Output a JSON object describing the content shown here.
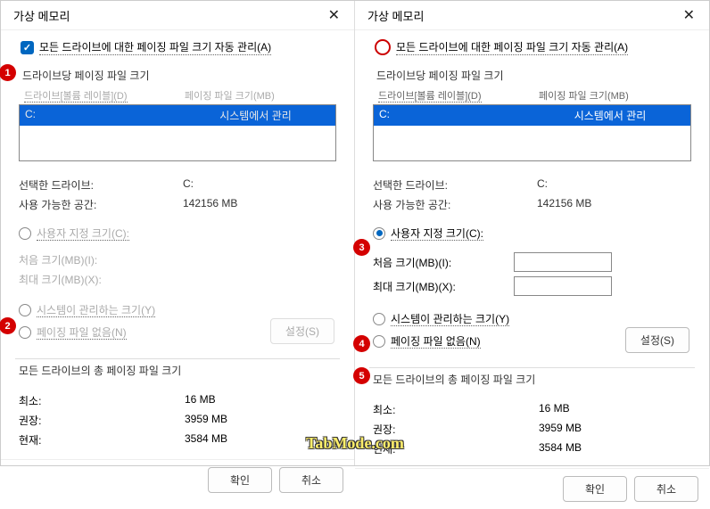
{
  "dialogs": {
    "title": "가상 메모리",
    "auto_manage": "모든 드라이브에 대한 페이징 파일 크기 자동 관리(A)",
    "group_drive": "드라이브당 페이징 파일 크기",
    "col_drive": "드라이브[볼륨 레이블](D)",
    "col_size": "페이징 파일 크기(MB)",
    "drive_letter": "C:",
    "drive_status": "시스템에서 관리",
    "selected_drive_lbl": "선택한 드라이브:",
    "selected_drive_val": "C:",
    "available_lbl": "사용 가능한 공간:",
    "available_val": "142156 MB",
    "radio_custom": "사용자 지정 크기(C):",
    "initial_label": "처음 크기(MB)(I):",
    "max_label": "최대 크기(MB)(X):",
    "radio_system": "시스템이 관리하는 크기(Y)",
    "radio_none": "페이징 파일 없음(N)",
    "set_btn": "설정(S)",
    "totals_group": "모든 드라이브의 총 페이징 파일 크기",
    "min_lbl": "최소:",
    "min_val": "16 MB",
    "rec_lbl": "권장:",
    "rec_val": "3959 MB",
    "cur_lbl": "현재:",
    "cur_val": "3584 MB",
    "ok_btn": "확인",
    "cancel_btn": "취소"
  },
  "watermark": "TabMode.com",
  "badges": {
    "b1": "1",
    "b2": "2",
    "b3": "3",
    "b4": "4",
    "b5": "5"
  }
}
